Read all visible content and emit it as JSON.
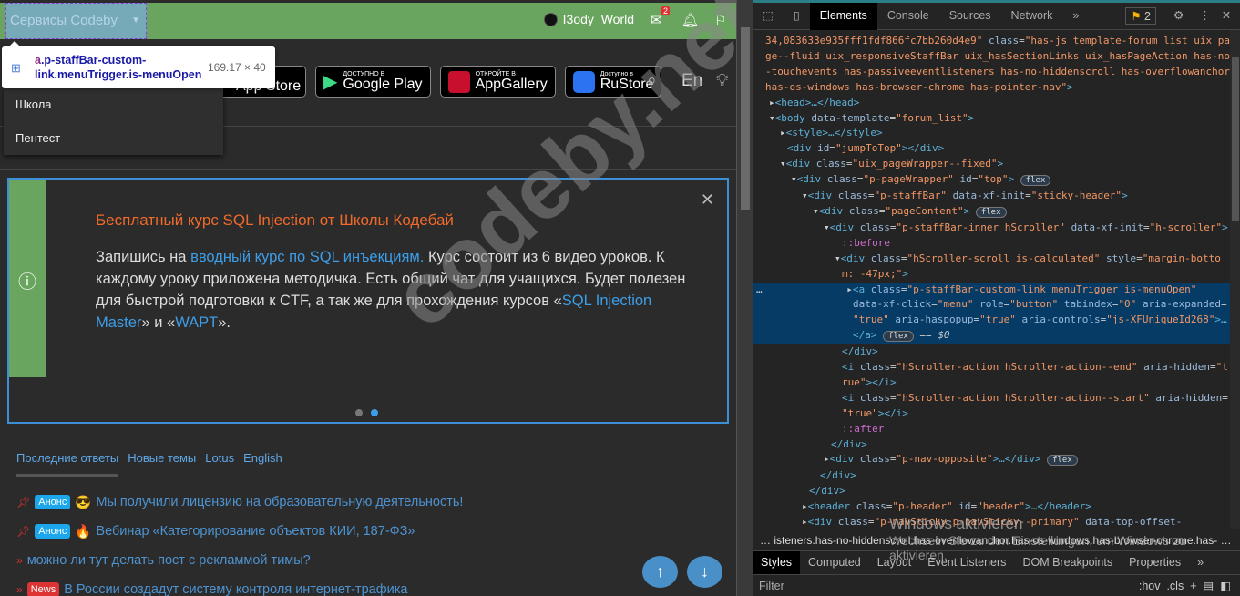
{
  "staffbar": {
    "services": "Сервисы Codeby",
    "username": "I3ody_World",
    "messages_count": "2"
  },
  "tooltip": {
    "selector_tag": "a",
    "selector_rest": ".p-staffBar-custom-link.menuTrigger.is-menuOpen",
    "size": "169.17 × 40"
  },
  "stores": [
    {
      "small": "",
      "big": "App Store"
    },
    {
      "small": "ДОСТУПНО В",
      "big": "Google Play"
    },
    {
      "small": "ОТКРОЙТЕ В",
      "big": "AppGallery"
    },
    {
      "small": "Доступно в",
      "big": "RuStore"
    }
  ],
  "lang": "En",
  "menu": [
    "Школа",
    "Пентест"
  ],
  "notice": {
    "title": "Бесплатный курс SQL Injection от Школы Кодебай",
    "t1": "Запишись на ",
    "link1": "вводный курс по SQL инъекциям.",
    "t2": " Курс состоит из 6 видео уроков. К каждому уроку приложена методичка. Есть общий чат для учащихся. Будет полезен для быстрой подготовки к CTF, а так же для прохождения курсов «",
    "link2": "SQL Injection Master",
    "t3": "» и «",
    "link3": "WAPT",
    "t4": "»."
  },
  "tabs": [
    "Последние ответы",
    "Новые темы",
    "Lotus",
    "English"
  ],
  "threads": [
    {
      "prefix": "pin",
      "tag": "Анонс",
      "tag_color": "#1ca7ec",
      "emoji": "😎",
      "title": "Мы получили лицензию на образовательную деятельность!"
    },
    {
      "prefix": "pin",
      "tag": "Анонс",
      "tag_color": "#1ca7ec",
      "emoji": "🔥",
      "title": "Вебинар «Категорирование объектов КИИ, 187-ФЗ»"
    },
    {
      "prefix": "arrow",
      "tag": "",
      "tag_color": "",
      "emoji": "",
      "title": "можно ли тут делать пост с рекламмой тимы?"
    },
    {
      "prefix": "arrow",
      "tag": "News",
      "tag_color": "#d33",
      "emoji": "",
      "title": "В России создадут систему контроля интернет-трафика"
    }
  ],
  "watermark": "codeby.net",
  "devtools": {
    "tabs": [
      "Elements",
      "Console",
      "Sources",
      "Network"
    ],
    "issues": "2",
    "breadcrumb": "isteners.has-no-hiddenscroll.has-overflowanchor.has-os-windows.has-browser-chrome.has-",
    "subtabs": [
      "Styles",
      "Computed",
      "Layout",
      "Event Listeners",
      "DOM Breakpoints",
      "Properties"
    ],
    "filter": "Filter",
    "hov": ":hov",
    "cls": ".cls",
    "win1": "Windows aktivieren",
    "win2": "Wechseln Sie zu den Einstellungen, um Windows zu aktivieren."
  }
}
